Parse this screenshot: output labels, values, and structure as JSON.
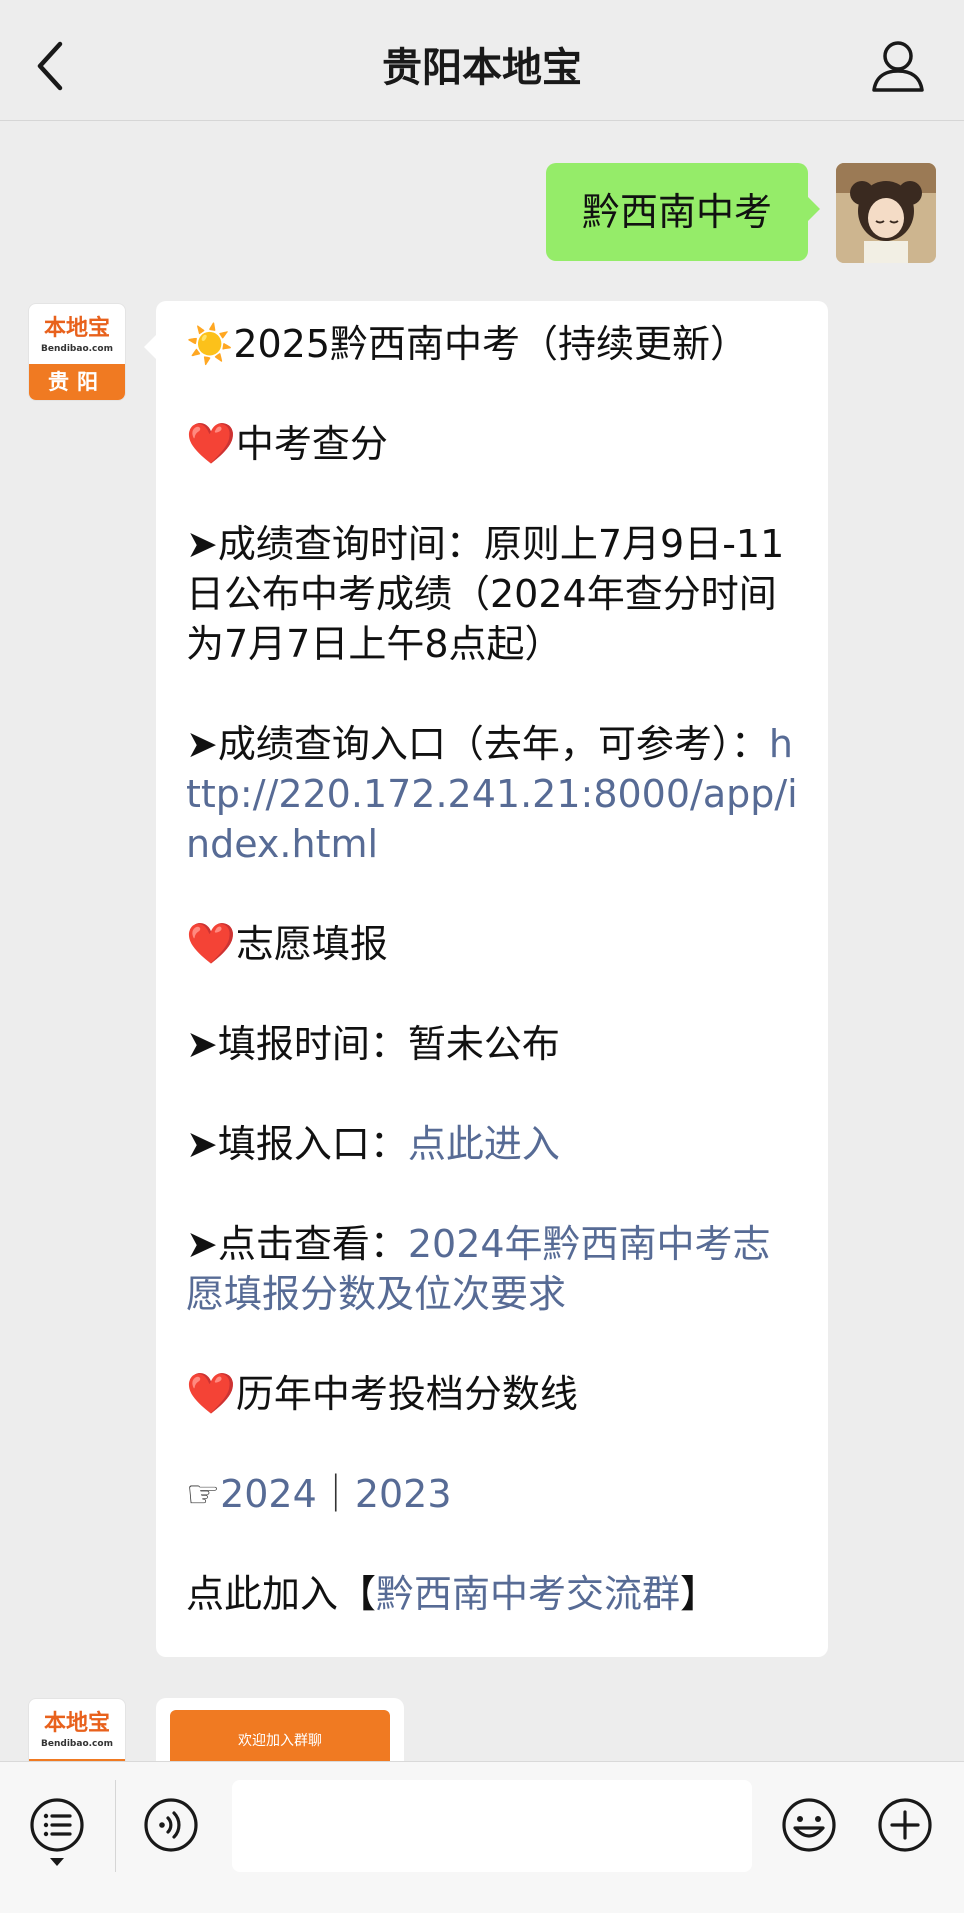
{
  "header": {
    "title": "贵阳本地宝",
    "back_icon": "chevron-left-icon",
    "profile_icon": "person-icon"
  },
  "sent_message": {
    "text": "黔西南中考"
  },
  "bot": {
    "logo_text": "本地宝",
    "logo_site": "Bendibao.com",
    "logo_city": "贵阳"
  },
  "received_message": {
    "title_emoji": "☀️",
    "title": "2025黔西南中考（持续更新）",
    "section1_emoji": "❤️",
    "section1": "中考查分",
    "time_label": "➤成绩查询时间：",
    "time_text": "原则上7月9日-11日公布中考成绩（2024年查分时间为7月7日上午8点起）",
    "entry_label": "➤成绩查询入口（去年，可参考）：",
    "entry_url": "http://220.172.241.21:8000/app/index.html",
    "section2_emoji": "❤️",
    "section2": "志愿填报",
    "fill_time_label": "➤填报时间：",
    "fill_time_text": "暂未公布",
    "fill_entry_label": "➤填报入口：",
    "fill_entry_link": "点此进入",
    "view_label": "➤点击查看：",
    "view_link": "2024年黔西南中考志愿填报分数及位次要求",
    "section3_emoji": "❤️",
    "section3": "历年中考投档分数线",
    "years_pointer": "☞",
    "year1": "2024",
    "year_sep": "｜",
    "year2": "2023",
    "join_prefix": "点此加入【",
    "join_link": "黔西南中考交流群",
    "join_suffix": "】"
  },
  "card_preview": {
    "banner_text": "欢迎加入群聊"
  },
  "toolbar": {
    "menu_icon": "list-menu-icon",
    "voice_icon": "voice-icon",
    "emoji_icon": "emoji-icon",
    "plus_icon": "plus-icon",
    "input_value": ""
  },
  "colors": {
    "sent_bubble": "#95ec69",
    "link": "#576b95",
    "brand_orange": "#f07a22",
    "background": "#ededed"
  }
}
